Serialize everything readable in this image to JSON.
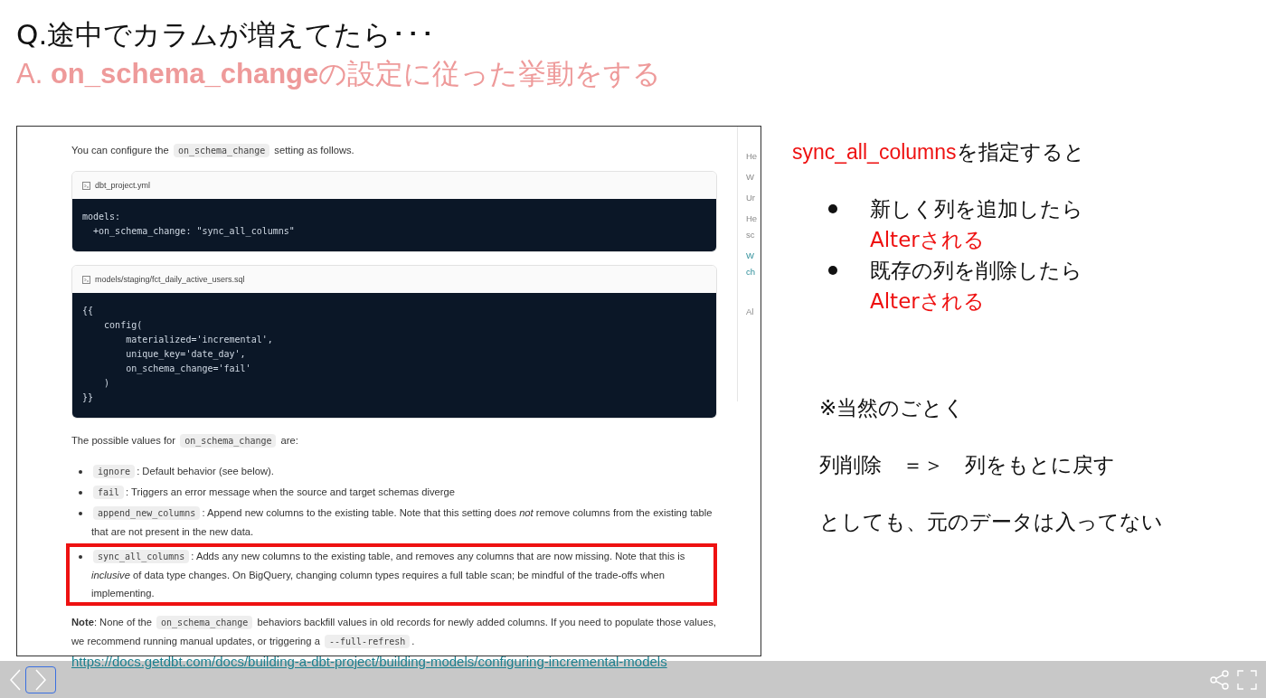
{
  "slide": {
    "question": "Q.途中でカラムが増えてたら･･･",
    "answer": "A. **on_schema_change**の設定に従った挙動をする",
    "doc": {
      "intro": [
        {
          "kind": "text",
          "text": "You can configure the "
        },
        {
          "kind": "code",
          "text": "on_schema_change"
        },
        {
          "kind": "text",
          "text": " setting as follows."
        }
      ],
      "code_blocks": [
        {
          "filename": "dbt_project.yml",
          "lines": [
            "models:",
            "  +on_schema_change: \"sync_all_columns\""
          ]
        },
        {
          "filename": "models/staging/fct_daily_active_users.sql",
          "lines": [
            "{{",
            "    config(",
            "        materialized='incremental',",
            "        unique_key='date_day',",
            "        on_schema_change='fail'",
            "    )",
            "}}"
          ]
        }
      ],
      "values_intro": [
        {
          "kind": "text",
          "text": "The possible values for "
        },
        {
          "kind": "code",
          "text": "on_schema_change"
        },
        {
          "kind": "text",
          "text": " are:"
        }
      ],
      "values": [
        {
          "highlighted": false,
          "parts": [
            {
              "kind": "code",
              "text": "ignore"
            },
            {
              "kind": "text",
              "text": ": Default behavior (see below)."
            }
          ]
        },
        {
          "highlighted": false,
          "parts": [
            {
              "kind": "code",
              "text": "fail"
            },
            {
              "kind": "text",
              "text": ": Triggers an error message when the source and target schemas diverge"
            }
          ]
        },
        {
          "highlighted": false,
          "parts": [
            {
              "kind": "code",
              "text": "append_new_columns"
            },
            {
              "kind": "text",
              "text": ": Append new columns to the existing table. Note that this setting does *not* remove columns from the existing table that are not present in the new data."
            }
          ]
        },
        {
          "highlighted": true,
          "parts": [
            {
              "kind": "code",
              "text": "sync_all_columns"
            },
            {
              "kind": "text",
              "text": ": Adds any new columns to the existing table, and removes any columns that are now missing. Note that this is *inclusive* of data type changes. On BigQuery, changing column types requires a full table scan; be mindful of the trade-offs when implementing."
            }
          ]
        }
      ],
      "note": [
        {
          "kind": "text",
          "text": "**Note**: None of the "
        },
        {
          "kind": "code",
          "text": "on_schema_change"
        },
        {
          "kind": "text",
          "text": " behaviors backfill values in old records for newly added columns. If you need to populate those values, we recommend running manual updates, or triggering a "
        },
        {
          "kind": "code",
          "text": "--full-refresh"
        },
        {
          "kind": "text",
          "text": "."
        }
      ],
      "toc": [
        {
          "lines": [
            "He"
          ],
          "selected": false
        },
        {
          "lines": [
            "W"
          ],
          "selected": false
        },
        {
          "lines": [
            "Ur"
          ],
          "selected": false
        },
        {
          "lines": [
            "He",
            "sc"
          ],
          "selected": false
        },
        {
          "lines": [
            "W",
            "ch"
          ],
          "selected": true
        },
        {
          "lines": [
            "Al"
          ],
          "selected": false
        }
      ]
    },
    "link": "https://docs.getdbt.com/docs/building-a-dbt-project/building-models/configuring-incremental-models",
    "side": {
      "heading": [
        {
          "kind": "accent",
          "text": "sync_all_columns"
        },
        {
          "kind": "text",
          "text": "を指定すると"
        }
      ],
      "bullets": [
        {
          "text": "新しく列を追加したら",
          "result": "Alterされる"
        },
        {
          "text": "既存の列を削除したら",
          "result": "Alterされる"
        }
      ],
      "notes": [
        "※当然のごとく",
        "列削除　＝＞　列をもとに戻す",
        "としても、元のデータは入ってない"
      ]
    }
  }
}
